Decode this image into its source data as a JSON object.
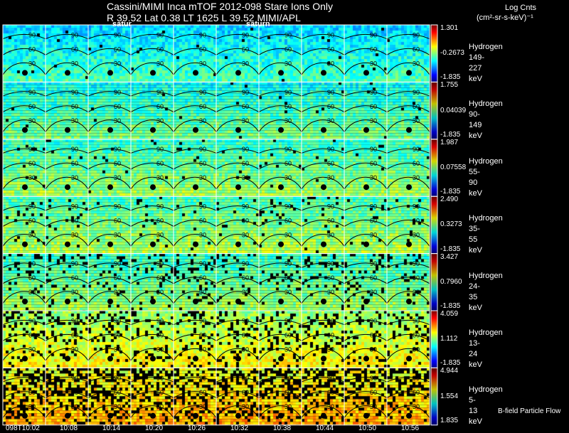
{
  "header": {
    "title_line1": "Cassini/MIMI Inca mTOF  2012-098   Stare   Ions Only",
    "title_line2": "R          39.52 Lat 0.38 LT 1625 L          39.52  MIMI/APL",
    "overlay_labels": [
      "satur",
      "saturn"
    ],
    "units_line1": "Log Cnts",
    "units_line2": "(cm²-sr-s-keV)⁻¹"
  },
  "footer_note": "B-field Particle Flow",
  "chart_data": {
    "type": "heatmap",
    "colormap": "jet",
    "arc_labels": [
      "30",
      "60",
      "90"
    ],
    "times": [
      "098T10:02",
      "10:08",
      "10:14",
      "10:20",
      "10:26",
      "10:32",
      "10:38",
      "10:44",
      "10:50",
      "10:56"
    ],
    "rows": [
      {
        "species": "Hydrogen",
        "energy": "149-227 keV",
        "max": "1.301",
        "mid": "-0.2673",
        "min": "-1.835"
      },
      {
        "species": "Hydrogen",
        "energy": "90-149 keV",
        "max": "1.755",
        "mid": "0.04039",
        "min": "-1.835"
      },
      {
        "species": "Hydrogen",
        "energy": "55-90 keV",
        "max": "1.987",
        "mid": "0.07558",
        "min": "-1.835"
      },
      {
        "species": "Hydrogen",
        "energy": "35-55 keV",
        "max": "2.490",
        "mid": "0.3273",
        "min": "-1.835"
      },
      {
        "species": "Hydrogen",
        "energy": "24-35 keV",
        "max": "3.427",
        "mid": "0.7960",
        "min": "-1.835"
      },
      {
        "species": "Hydrogen",
        "energy": "13-24 keV",
        "max": "4.059",
        "mid": "1.112",
        "min": "-1.835"
      },
      {
        "species": "Hydrogen",
        "energy": "5-13 keV",
        "max": "4.944",
        "mid": "1.554",
        "min": "1.835"
      }
    ]
  }
}
